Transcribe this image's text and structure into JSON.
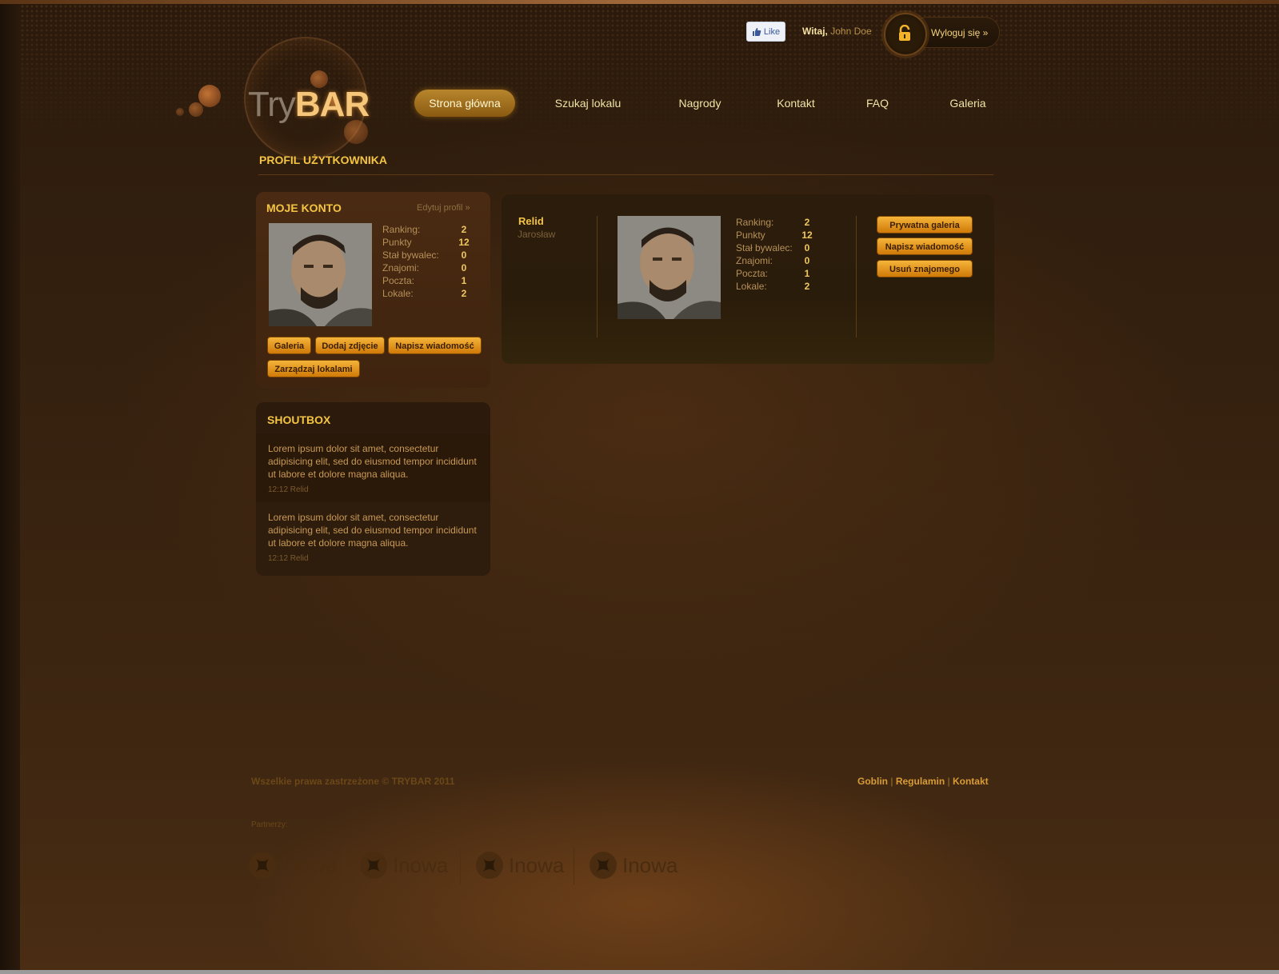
{
  "header": {
    "like_label": "Like",
    "welcome_label": "Witaj,",
    "user_name": "John Doe",
    "logout_label": "Wyloguj się »"
  },
  "logo": {
    "try": "Try",
    "bar": "BAR"
  },
  "nav": {
    "items": [
      {
        "label": "Strona główna",
        "active": true
      },
      {
        "label": "Szukaj lokalu"
      },
      {
        "label": "Nagrody"
      },
      {
        "label": "Kontakt"
      },
      {
        "label": "FAQ"
      },
      {
        "label": "Galeria"
      }
    ]
  },
  "page_title": "PROFIL UŻYTKOWNIKA",
  "account": {
    "title": "MOJE KONTO",
    "edit_link": "Edytuj profil »",
    "stats": [
      {
        "label": "Ranking:",
        "value": "2"
      },
      {
        "label": "Punkty",
        "value": "12"
      },
      {
        "label": "Stał bywalec:",
        "value": "0"
      },
      {
        "label": "Znajomi:",
        "value": "0"
      },
      {
        "label": "Poczta:",
        "value": "1"
      },
      {
        "label": "Lokale:",
        "value": "2"
      }
    ],
    "buttons": [
      "Galeria",
      "Dodaj zdjęcie",
      "Napisz wiadomość",
      "Zarządzaj lokalami"
    ]
  },
  "friend": {
    "nick": "Relid",
    "name": "Jarosław",
    "stats": [
      {
        "label": "Ranking:",
        "value": "2"
      },
      {
        "label": "Punkty",
        "value": "12"
      },
      {
        "label": "Stał bywalec:",
        "value": "0"
      },
      {
        "label": "Znajomi:",
        "value": "0"
      },
      {
        "label": "Poczta:",
        "value": "1"
      },
      {
        "label": "Lokale:",
        "value": "2"
      }
    ],
    "buttons": [
      "Prywatna galeria",
      "Napisz wiadomość",
      "Usuń znajomego"
    ]
  },
  "shoutbox": {
    "title": "SHOUTBOX",
    "items": [
      {
        "text": "Lorem ipsum dolor sit amet, consectetur adipisicing elit, sed do eiusmod tempor incididunt ut labore et dolore magna aliqua.",
        "meta": "12:12 Relid"
      },
      {
        "text": "Lorem ipsum dolor sit amet, consectetur adipisicing elit, sed do eiusmod tempor incididunt ut labore et dolore magna aliqua.",
        "meta": "12:12 Relid"
      }
    ]
  },
  "footer": {
    "copyright": "Wszelkie prawa zastrzeżone © TRYBAR 2011",
    "links": [
      "Goblin",
      "Regulamin",
      "Kontakt"
    ],
    "link_sep": "|",
    "partners_label": "Partnerzy:",
    "partners": [
      "Inowa",
      "Inowa",
      "Inowa",
      "Inowa"
    ]
  }
}
